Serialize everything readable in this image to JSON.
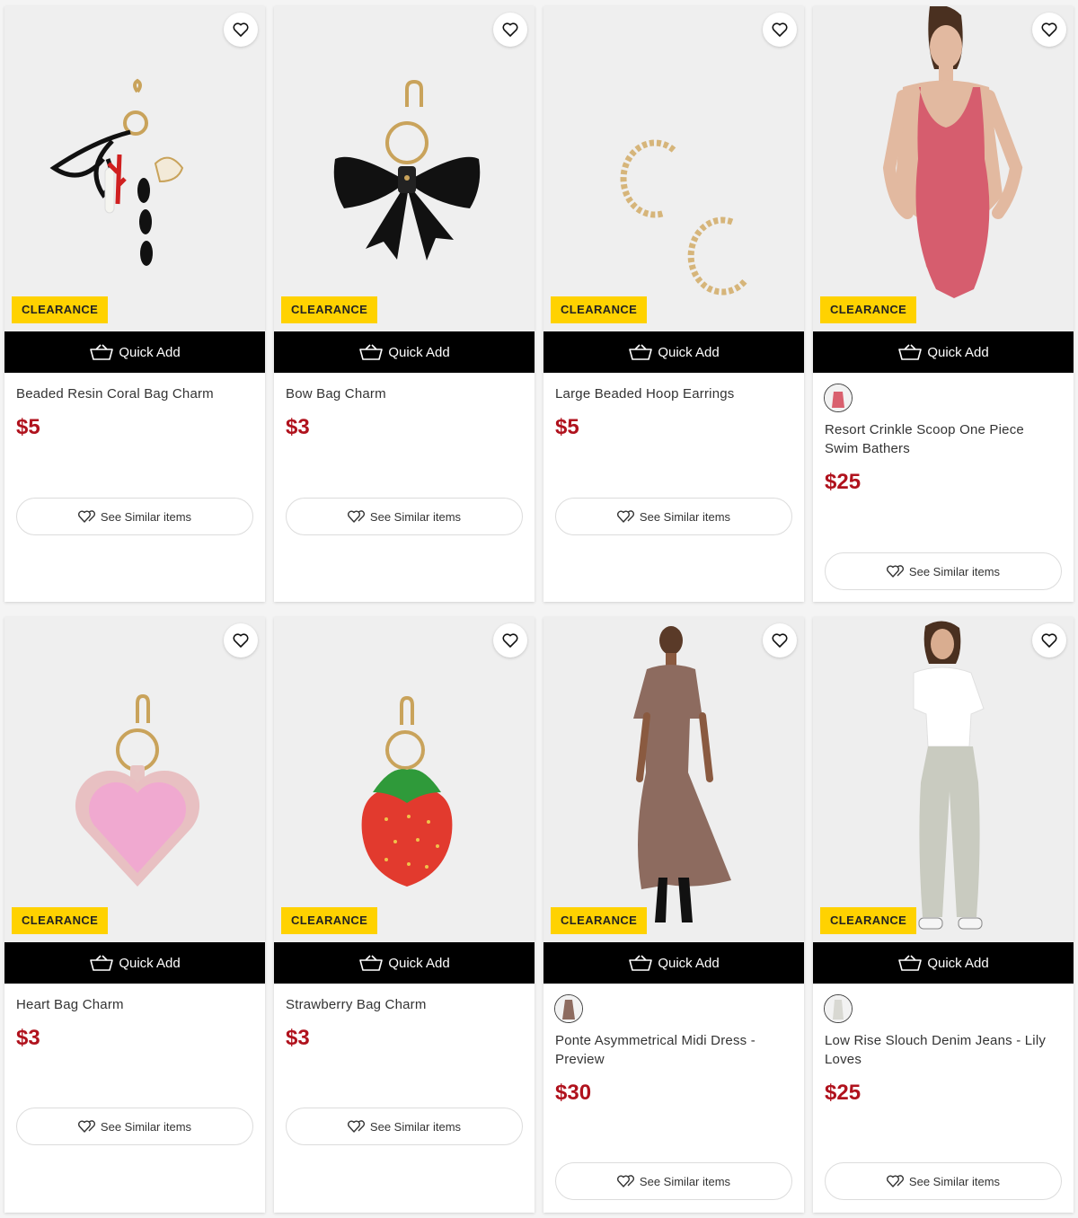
{
  "labels": {
    "clearance": "CLEARANCE",
    "quick_add": "Quick Add",
    "see_similar": "See Similar items"
  },
  "colors": {
    "badge": "#ffd200",
    "price": "#b0121d",
    "quick_add_bg": "#000000"
  },
  "icons": {
    "wishlist": "heart-icon",
    "quick_add": "basket-icon",
    "similar": "hearts-icon"
  },
  "products": [
    {
      "name": "Beaded Resin Coral Bag Charm",
      "price": "$5",
      "image": "coral-bag-charm",
      "has_swatch": false
    },
    {
      "name": "Bow Bag Charm",
      "price": "$3",
      "image": "bow-bag-charm",
      "has_swatch": false
    },
    {
      "name": "Large Beaded Hoop Earrings",
      "price": "$5",
      "image": "hoop-earrings",
      "has_swatch": false
    },
    {
      "name": "Resort Crinkle Scoop One Piece Swim Bathers",
      "price": "$25",
      "image": "pink-swimsuit",
      "has_swatch": true,
      "swatch_color": "#d9606e"
    },
    {
      "name": "Heart Bag Charm",
      "price": "$3",
      "image": "heart-bag-charm",
      "has_swatch": false
    },
    {
      "name": "Strawberry Bag Charm",
      "price": "$3",
      "image": "strawberry-bag-charm",
      "has_swatch": false
    },
    {
      "name": "Ponte Asymmetrical Midi Dress - Preview",
      "price": "$30",
      "image": "brown-midi-dress",
      "has_swatch": true,
      "swatch_color": "#8d6b5f"
    },
    {
      "name": "Low Rise Slouch Denim Jeans - Lily Loves",
      "price": "$25",
      "image": "grey-denim-jeans",
      "has_swatch": true,
      "swatch_color": "#e8e8e4"
    }
  ]
}
